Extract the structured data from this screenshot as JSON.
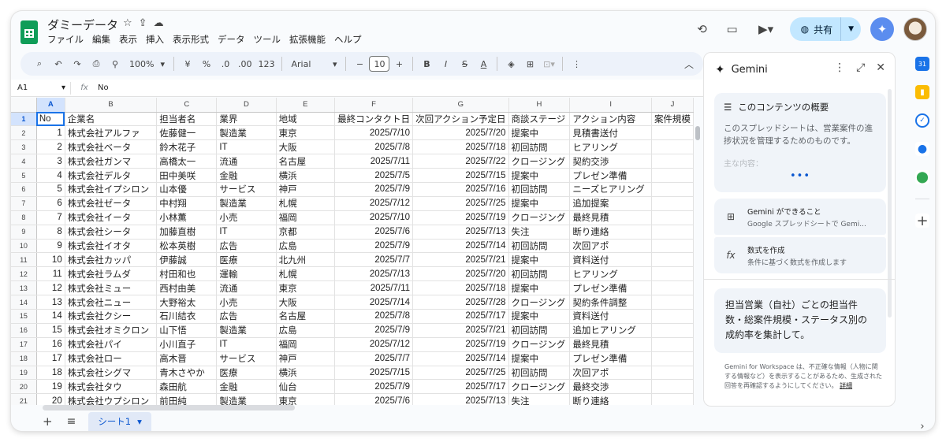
{
  "app": {
    "doc_title": "ダミーデータ",
    "menu": [
      "ファイル",
      "編集",
      "表示",
      "挿入",
      "表示形式",
      "データ",
      "ツール",
      "拡張機能",
      "ヘルプ"
    ],
    "share_label": "共有"
  },
  "toolbar": {
    "zoom": "100%",
    "currency": "¥",
    "percent": "%",
    "dec_decrease": ".0",
    "dec_increase": ".00",
    "number_format": "123",
    "font": "Arial",
    "font_size": "10"
  },
  "formula_bar": {
    "cell_ref": "A1",
    "fx": "fx",
    "value": "No"
  },
  "grid": {
    "columns": [
      "A",
      "B",
      "C",
      "D",
      "E",
      "F",
      "G",
      "H",
      "I",
      "J"
    ],
    "row_numbers": [
      "1",
      "2",
      "3",
      "4",
      "5",
      "6",
      "7",
      "8",
      "9",
      "10",
      "11",
      "12",
      "13",
      "14",
      "15",
      "16",
      "17",
      "18",
      "19",
      "20",
      "21"
    ],
    "headers": [
      "No",
      "企業名",
      "担当者名",
      "業界",
      "地域",
      "最終コンタクト日",
      "次回アクション予定日",
      "商談ステージ",
      "アクション内容",
      "案件規模"
    ],
    "rows": [
      [
        "1",
        "株式会社アルファ",
        "佐藤健一",
        "製造業",
        "東京",
        "2025/7/10",
        "2025/7/20",
        "提案中",
        "見積書送付"
      ],
      [
        "2",
        "株式会社ベータ",
        "鈴木花子",
        "IT",
        "大阪",
        "2025/7/8",
        "2025/7/18",
        "初回訪問",
        "ヒアリング"
      ],
      [
        "3",
        "株式会社ガンマ",
        "高橋太一",
        "流通",
        "名古屋",
        "2025/7/11",
        "2025/7/22",
        "クロージング",
        "契約交渉"
      ],
      [
        "4",
        "株式会社デルタ",
        "田中美咲",
        "金融",
        "横浜",
        "2025/7/5",
        "2025/7/15",
        "提案中",
        "プレゼン準備"
      ],
      [
        "5",
        "株式会社イプシロン",
        "山本優",
        "サービス",
        "神戸",
        "2025/7/9",
        "2025/7/16",
        "初回訪問",
        "ニーズヒアリング"
      ],
      [
        "6",
        "株式会社ゼータ",
        "中村翔",
        "製造業",
        "札幌",
        "2025/7/12",
        "2025/7/25",
        "提案中",
        "追加提案"
      ],
      [
        "7",
        "株式会社イータ",
        "小林薫",
        "小売",
        "福岡",
        "2025/7/10",
        "2025/7/19",
        "クロージング",
        "最終見積"
      ],
      [
        "8",
        "株式会社シータ",
        "加藤直樹",
        "IT",
        "京都",
        "2025/7/6",
        "2025/7/13",
        "失注",
        "断り連絡"
      ],
      [
        "9",
        "株式会社イオタ",
        "松本英樹",
        "広告",
        "広島",
        "2025/7/9",
        "2025/7/14",
        "初回訪問",
        "次回アポ"
      ],
      [
        "10",
        "株式会社カッパ",
        "伊藤誠",
        "医療",
        "北九州",
        "2025/7/7",
        "2025/7/21",
        "提案中",
        "資料送付"
      ],
      [
        "11",
        "株式会社ラムダ",
        "村田和也",
        "運輸",
        "札幌",
        "2025/7/13",
        "2025/7/20",
        "初回訪問",
        "ヒアリング"
      ],
      [
        "12",
        "株式会社ミュー",
        "西村由美",
        "流通",
        "東京",
        "2025/7/11",
        "2025/7/18",
        "提案中",
        "プレゼン準備"
      ],
      [
        "13",
        "株式会社ニュー",
        "大野裕太",
        "小売",
        "大阪",
        "2025/7/14",
        "2025/7/28",
        "クロージング",
        "契約条件調整"
      ],
      [
        "14",
        "株式会社クシー",
        "石川結衣",
        "広告",
        "名古屋",
        "2025/7/8",
        "2025/7/17",
        "提案中",
        "資料送付"
      ],
      [
        "15",
        "株式会社オミクロン",
        "山下悟",
        "製造業",
        "広島",
        "2025/7/9",
        "2025/7/21",
        "初回訪問",
        "追加ヒアリング"
      ],
      [
        "16",
        "株式会社パイ",
        "小川直子",
        "IT",
        "福岡",
        "2025/7/12",
        "2025/7/19",
        "クロージング",
        "最終見積"
      ],
      [
        "17",
        "株式会社ロー",
        "高木晋",
        "サービス",
        "神戸",
        "2025/7/7",
        "2025/7/14",
        "提案中",
        "プレゼン準備"
      ],
      [
        "18",
        "株式会社シグマ",
        "青木さやか",
        "医療",
        "横浜",
        "2025/7/15",
        "2025/7/25",
        "初回訪問",
        "次回アポ"
      ],
      [
        "19",
        "株式会社タウ",
        "森田航",
        "金融",
        "仙台",
        "2025/7/9",
        "2025/7/17",
        "クロージング",
        "最終交渉"
      ],
      [
        "20",
        "株式会社ウプシロン",
        "前田純",
        "製造業",
        "東京",
        "2025/7/6",
        "2025/7/13",
        "失注",
        "断り連絡"
      ]
    ]
  },
  "sheet_bar": {
    "active_sheet": "シート1"
  },
  "gemini": {
    "title": "Gemini",
    "overview_title": "このコンテンツの概要",
    "overview_body": "このスプレッドシートは、営業案件の進捗状況を管理するためのものです。",
    "overview_faded": "主な内容：",
    "overview_more": "•••",
    "feature1_title": "Gemini ができること",
    "feature1_sub": "Google スプレッドシートで Gemi...",
    "feature2_title": "数式を作成",
    "feature2_sub": "条件に基づく数式を作成します",
    "prompt": "担当営業（自社）ごとの担当件数・総案件規模・ステータス別の成約率を集計して。",
    "disclaimer": "Gemini for Workspace は、不正確な情報（人物に関する情報など）を表示することがあるため、生成された回答を再確認するようにしてください。",
    "disclaimer_link": "詳細"
  }
}
